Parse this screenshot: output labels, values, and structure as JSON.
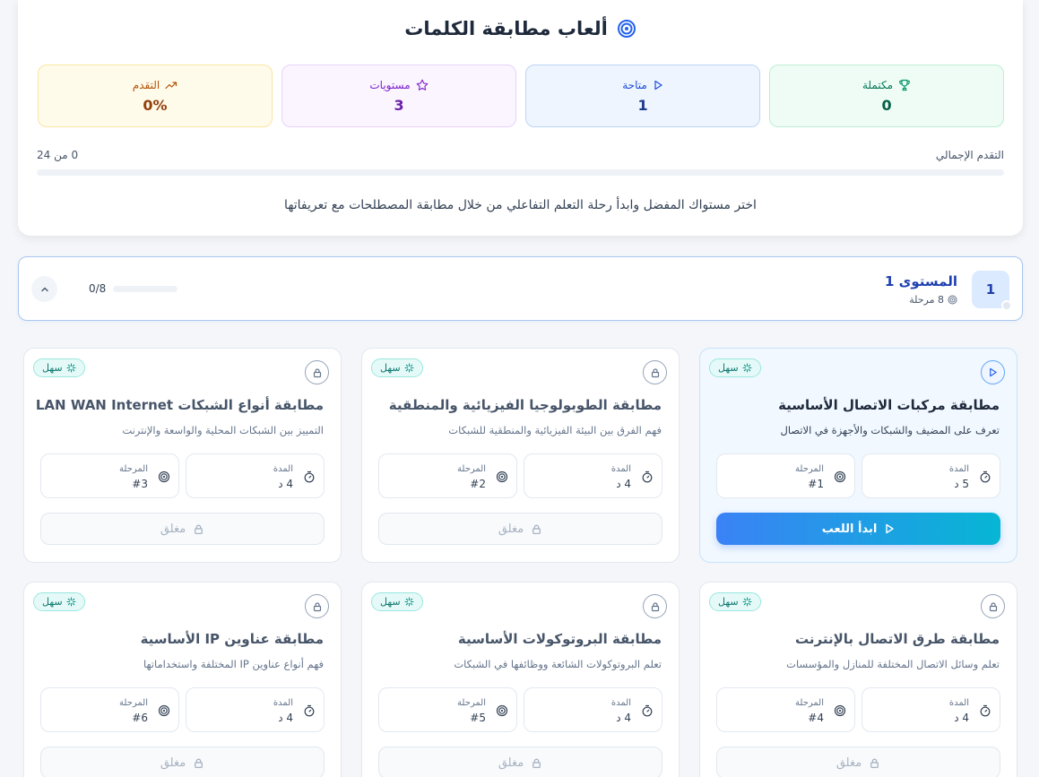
{
  "header": {
    "title": "ألعاب مطابقة الكلمات",
    "intro": "اختر مستواك المفضل وابدأ رحلة التعلم التفاعلي من خلال مطابقة المصطلحات مع تعريفاتها"
  },
  "stats": {
    "completed": {
      "label": "مكتملة",
      "value": "0"
    },
    "available": {
      "label": "متاحة",
      "value": "1"
    },
    "levels": {
      "label": "مستويات",
      "value": "3"
    },
    "progress": {
      "label": "التقدم",
      "value": "0%"
    }
  },
  "overall": {
    "label": "التقدم الإجمالي",
    "count": "0 من 24",
    "progress_fraction": 0
  },
  "level": {
    "number": "1",
    "title": "المستوى 1",
    "stages": "8 مرحلة",
    "progress_text": "0/8",
    "progress_fraction": 0
  },
  "labels": {
    "duration": "المدة",
    "stage": "المرحلة",
    "start": "ابدأ اللعب",
    "locked": "مغلق"
  },
  "cards": [
    {
      "difficulty": "سهل",
      "title": "مطابقة مركبات الاتصال الأساسية",
      "desc": "تعرف على المضيف والشبكات والأجهزة في الاتصال",
      "duration": "5 د",
      "stage": "#1",
      "state": "available"
    },
    {
      "difficulty": "سهل",
      "title": "مطابقة الطوبولوجيا الفيزيائية والمنطقية",
      "desc": "فهم الفرق بين البيئة الفيزيائية والمنطقية للشبكات",
      "duration": "4 د",
      "stage": "#2",
      "state": "locked"
    },
    {
      "difficulty": "سهل",
      "title": "مطابقة أنواع الشبكات LAN WAN Internet",
      "desc": "التمييز بين الشبكات المحلية والواسعة والإنترنت",
      "duration": "4 د",
      "stage": "#3",
      "state": "locked"
    },
    {
      "difficulty": "سهل",
      "title": "مطابقة طرق الاتصال بالإنترنت",
      "desc": "تعلم وسائل الاتصال المختلفة للمنازل والمؤسسات",
      "duration": "4 د",
      "stage": "#4",
      "state": "locked"
    },
    {
      "difficulty": "سهل",
      "title": "مطابقة البروتوكولات الأساسية",
      "desc": "تعلم البروتوكولات الشائعة ووظائفها في الشبكات",
      "duration": "4 د",
      "stage": "#5",
      "state": "locked"
    },
    {
      "difficulty": "سهل",
      "title": "مطابقة عناوين IP الأساسية",
      "desc": "فهم أنواع عناوين IP المختلفة واستخداماتها",
      "duration": "4 د",
      "stage": "#6",
      "state": "locked"
    }
  ]
}
